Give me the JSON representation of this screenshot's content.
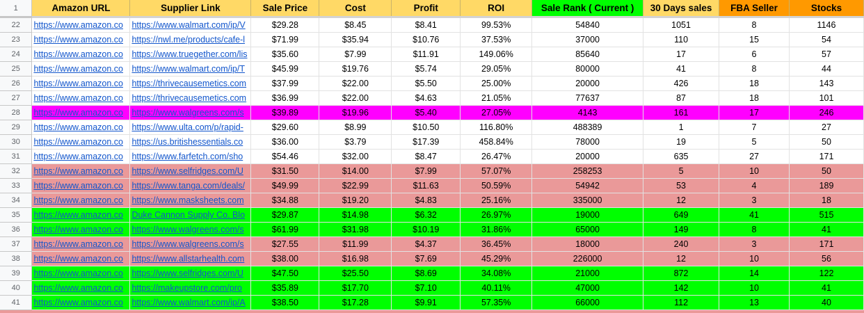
{
  "colors": {
    "header_yellow": "#ffd966",
    "header_green": "#00ff00",
    "header_orange": "#ff9900",
    "row_white": "#ffffff",
    "row_magenta": "#ff00ff",
    "row_pink": "#ea9999",
    "row_green": "#00ff00",
    "link": "#1155cc"
  },
  "header": {
    "rownum": "1",
    "columns": [
      {
        "label": "Amazon URL",
        "color": "yellow"
      },
      {
        "label": "Supplier Link",
        "color": "yellow"
      },
      {
        "label": "Sale Price",
        "color": "yellow"
      },
      {
        "label": "Cost",
        "color": "yellow"
      },
      {
        "label": "Profit",
        "color": "yellow"
      },
      {
        "label": "ROI",
        "color": "yellow"
      },
      {
        "label": "Sale Rank ( Current )",
        "color": "green"
      },
      {
        "label": "30 Days sales",
        "color": "yellow"
      },
      {
        "label": "FBA Seller",
        "color": "orange"
      },
      {
        "label": "Stocks",
        "color": "orange"
      }
    ]
  },
  "rows": [
    {
      "n": "22",
      "amazon": "https://www.amazon.co",
      "supplier": "https://www.walmart.com/ip/V",
      "price": "$29.28",
      "cost": "$8.45",
      "profit": "$8.41",
      "roi": "99.53%",
      "rank": "54840",
      "sales": "1051",
      "fba": "8",
      "stocks": "1146",
      "color": "white"
    },
    {
      "n": "23",
      "amazon": "https://www.amazon.co",
      "supplier": "https://nwl.me/products/cafe-l",
      "price": "$71.99",
      "cost": "$35.94",
      "profit": "$10.76",
      "roi": "37.53%",
      "rank": "37000",
      "sales": "110",
      "fba": "15",
      "stocks": "54",
      "color": "white"
    },
    {
      "n": "24",
      "amazon": "https://www.amazon.co",
      "supplier": "https://www.truegether.com/lis",
      "price": "$35.60",
      "cost": "$7.99",
      "profit": "$11.91",
      "roi": "149.06%",
      "rank": "85640",
      "sales": "17",
      "fba": "6",
      "stocks": "57",
      "color": "white"
    },
    {
      "n": "25",
      "amazon": "https://www.amazon.co",
      "supplier": "https://www.walmart.com/ip/T",
      "price": "$45.99",
      "cost": "$19.76",
      "profit": "$5.74",
      "roi": "29.05%",
      "rank": "80000",
      "sales": "41",
      "fba": "8",
      "stocks": "44",
      "color": "white"
    },
    {
      "n": "26",
      "amazon": "https://www.amazon.co",
      "supplier": "https://thrivecausemetics.com",
      "price": "$37.99",
      "cost": "$22.00",
      "profit": "$5.50",
      "roi": "25.00%",
      "rank": "20000",
      "sales": "426",
      "fba": "18",
      "stocks": "143",
      "color": "white"
    },
    {
      "n": "27",
      "amazon": "https://www.amazon.co",
      "supplier": "https://thrivecausemetics.com",
      "price": "$36.99",
      "cost": "$22.00",
      "profit": "$4.63",
      "roi": "21.05%",
      "rank": "77637",
      "sales": "87",
      "fba": "18",
      "stocks": "101",
      "color": "white"
    },
    {
      "n": "28",
      "amazon": "https://www.amazon.co",
      "supplier": "https://www.walgreens.com/s",
      "price": "$39.89",
      "cost": "$19.96",
      "profit": "$5.40",
      "roi": "27.05%",
      "rank": "4143",
      "sales": "161",
      "fba": "17",
      "stocks": "246",
      "color": "magenta"
    },
    {
      "n": "29",
      "amazon": "https://www.amazon.co",
      "supplier": "https://www.ulta.com/p/rapid-",
      "price": "$29.60",
      "cost": "$8.99",
      "profit": "$10.50",
      "roi": "116.80%",
      "rank": "488389",
      "sales": "1",
      "fba": "7",
      "stocks": "27",
      "color": "white"
    },
    {
      "n": "30",
      "amazon": "https://www.amazon.co",
      "supplier": "https://us.britishessentials.co",
      "price": "$36.00",
      "cost": "$3.79",
      "profit": "$17.39",
      "roi": "458.84%",
      "rank": "78000",
      "sales": "19",
      "fba": "5",
      "stocks": "50",
      "color": "white"
    },
    {
      "n": "31",
      "amazon": "https://www.amazon.co",
      "supplier": "https://www.farfetch.com/sho",
      "price": "$54.46",
      "cost": "$32.00",
      "profit": "$8.47",
      "roi": "26.47%",
      "rank": "20000",
      "sales": "635",
      "fba": "27",
      "stocks": "171",
      "color": "white"
    },
    {
      "n": "32",
      "amazon": "https://www.amazon.co",
      "supplier": "https://www.selfridges.com/U",
      "price": "$31.50",
      "cost": "$14.00",
      "profit": "$7.99",
      "roi": "57.07%",
      "rank": "258253",
      "sales": "5",
      "fba": "10",
      "stocks": "50",
      "color": "pink"
    },
    {
      "n": "33",
      "amazon": "https://www.amazon.co",
      "supplier": "https://www.tanga.com/deals/",
      "price": "$49.99",
      "cost": "$22.99",
      "profit": "$11.63",
      "roi": "50.59%",
      "rank": "54942",
      "sales": "53",
      "fba": "4",
      "stocks": "189",
      "color": "pink"
    },
    {
      "n": "34",
      "amazon": "https://www.amazon.co",
      "supplier": "https://www.masksheets.com",
      "price": "$34.88",
      "cost": "$19.20",
      "profit": "$4.83",
      "roi": "25.16%",
      "rank": "335000",
      "sales": "12",
      "fba": "3",
      "stocks": "18",
      "color": "pink"
    },
    {
      "n": "35",
      "amazon": "https://www.amazon.co",
      "supplier": "Duke Cannon Supply Co. Blo",
      "price": "$29.87",
      "cost": "$14.98",
      "profit": "$6.32",
      "roi": "26.97%",
      "rank": "19000",
      "sales": "649",
      "fba": "41",
      "stocks": "515",
      "color": "green"
    },
    {
      "n": "36",
      "amazon": "https://www.amazon.co",
      "supplier": "https://www.walgreens.com/s",
      "price": "$61.99",
      "cost": "$31.98",
      "profit": "$10.19",
      "roi": "31.86%",
      "rank": "65000",
      "sales": "149",
      "fba": "8",
      "stocks": "41",
      "color": "green"
    },
    {
      "n": "37",
      "amazon": "https://www.amazon.co",
      "supplier": "https://www.walgreens.com/s",
      "price": "$27.55",
      "cost": "$11.99",
      "profit": "$4.37",
      "roi": "36.45%",
      "rank": "18000",
      "sales": "240",
      "fba": "3",
      "stocks": "171",
      "color": "pink"
    },
    {
      "n": "38",
      "amazon": "https://www.amazon.co",
      "supplier": "https://www.allstarhealth.com",
      "price": "$38.00",
      "cost": "$16.98",
      "profit": "$7.69",
      "roi": "45.29%",
      "rank": "226000",
      "sales": "12",
      "fba": "10",
      "stocks": "56",
      "color": "pink"
    },
    {
      "n": "39",
      "amazon": "https://www.amazon.co",
      "supplier": "https://www.selfridges.com/U",
      "price": "$47.50",
      "cost": "$25.50",
      "profit": "$8.69",
      "roi": "34.08%",
      "rank": "21000",
      "sales": "872",
      "fba": "14",
      "stocks": "122",
      "color": "green"
    },
    {
      "n": "40",
      "amazon": "https://www.amazon.co",
      "supplier": "https://makeupstore.com/pro",
      "price": "$35.89",
      "cost": "$17.70",
      "profit": "$7.10",
      "roi": "40.11%",
      "rank": "47000",
      "sales": "142",
      "fba": "10",
      "stocks": "41",
      "color": "green"
    },
    {
      "n": "41",
      "amazon": "https://www.amazon.co",
      "supplier": "https://www.walmart.com/ip/A",
      "price": "$38.50",
      "cost": "$17.28",
      "profit": "$9.91",
      "roi": "57.35%",
      "rank": "66000",
      "sales": "112",
      "fba": "13",
      "stocks": "40",
      "color": "green"
    }
  ]
}
